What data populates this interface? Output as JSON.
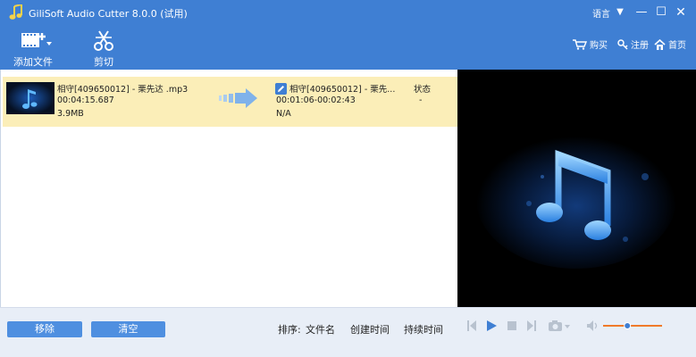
{
  "window": {
    "title": "GiliSoft Audio Cutter 8.0.0 (试用)",
    "language": "语言"
  },
  "toolbar": {
    "add_file_label": "添加文件",
    "cut_label": "剪切",
    "buy_label": "购买",
    "register_label": "注册",
    "home_label": "首页"
  },
  "file": {
    "source_name": "相守[409650012] - 栗先达 .mp3",
    "source_duration": "00:04:15.687",
    "source_size": "3.9MB",
    "output_name": "相守[409650012] - 栗先...",
    "output_range": "00:01:06-00:02:43",
    "output_size": "N/A",
    "status_header": "状态",
    "status_value": "-"
  },
  "bottom": {
    "remove_label": "移除",
    "clear_label": "清空",
    "sort_label": "排序:",
    "sort_by_name": "文件名",
    "sort_by_created": "创建时间",
    "sort_by_duration": "持续时间"
  },
  "player": {
    "volume_fraction": 0.4
  },
  "colors": {
    "accent": "#3f7fd3",
    "row_highlight": "#fbeeb8",
    "button": "#4f8fe0",
    "volume": "#f07a2a"
  }
}
